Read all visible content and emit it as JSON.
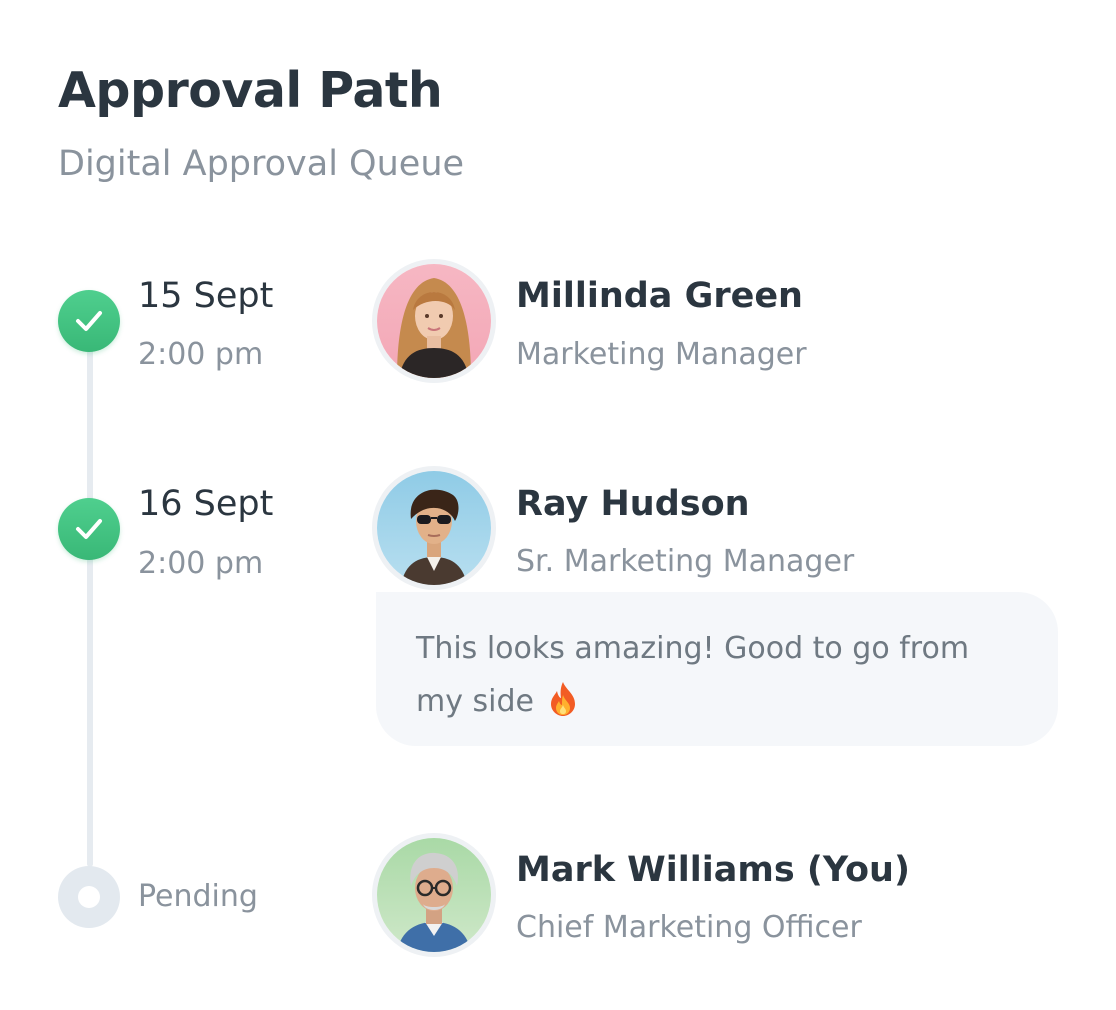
{
  "header": {
    "title": "Approval Path",
    "subtitle": "Digital Approval Queue"
  },
  "colors": {
    "approved": "#3ec282",
    "pending": "#e3e9ef",
    "text_primary": "#2b3640",
    "text_secondary": "#8a939d",
    "comment_bg": "#f5f7fa"
  },
  "steps": [
    {
      "status": "approved",
      "status_icon": "check-icon",
      "date": "15 Sept",
      "time": "2:00 pm",
      "name": "Millinda Green",
      "role": "Marketing Manager"
    },
    {
      "status": "approved",
      "status_icon": "check-icon",
      "date": "16 Sept",
      "time": "2:00 pm",
      "name": "Ray Hudson",
      "role": "Sr. Marketing Manager",
      "comment": {
        "line1": "This looks amazing! Good to go from",
        "line2": "my side",
        "emoji_icon": "fire-icon"
      }
    },
    {
      "status": "pending",
      "status_icon": "pending-ring-icon",
      "pending_label": "Pending",
      "name": "Mark Williams (You)",
      "role": "Chief Marketing Officer"
    }
  ]
}
